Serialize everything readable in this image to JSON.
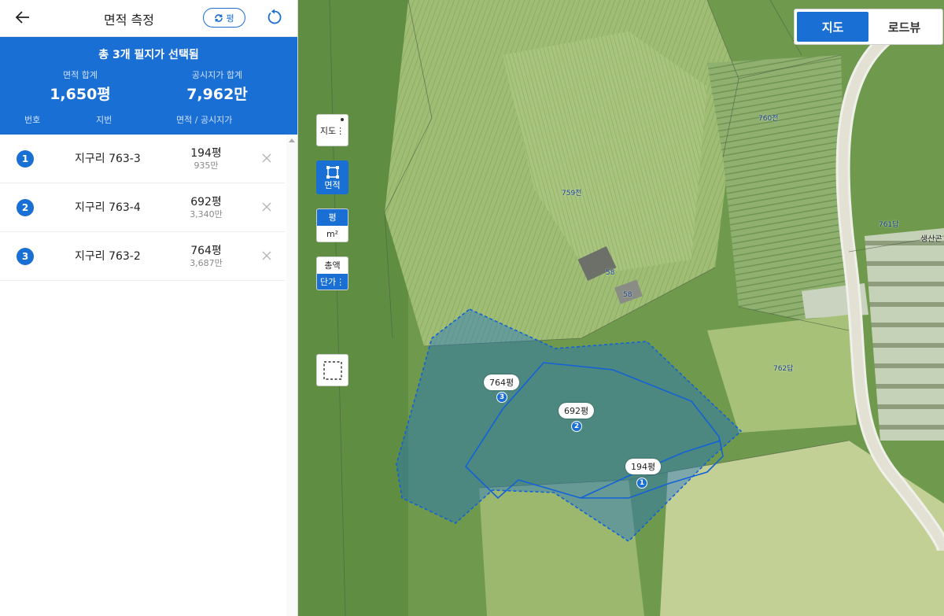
{
  "header": {
    "title": "면적 측정",
    "unit_toggle_label": "평"
  },
  "summary": {
    "title": "총 3개 필지가 선택됨",
    "area_label": "면적 합계",
    "area_value": "1,650평",
    "price_label": "공시지가 합계",
    "price_value": "7,962만"
  },
  "columns": {
    "num": "번호",
    "jibun": "지번",
    "area_price": "면적 / 공시지가"
  },
  "parcels": [
    {
      "num": "1",
      "jibun": "지구리 763-3",
      "area": "194평",
      "price": "935만"
    },
    {
      "num": "2",
      "jibun": "지구리 763-4",
      "area": "692평",
      "price": "3,340만"
    },
    {
      "num": "3",
      "jibun": "지구리 763-2",
      "area": "764평",
      "price": "3,687만"
    }
  ],
  "map_toggle": {
    "map": "지도",
    "roadview": "로드뷰"
  },
  "tools": {
    "map_layer": "지도",
    "area": "면적",
    "unit_pyeong": "평",
    "unit_sqm": "m²",
    "total_price": "총액",
    "unit_price": "단가"
  },
  "polygon_labels": [
    {
      "area": "764평",
      "num": "3"
    },
    {
      "area": "692평",
      "num": "2"
    },
    {
      "area": "194평",
      "num": "1"
    }
  ],
  "lot_labels": [
    "760전",
    "759전",
    "761답",
    "762답",
    "58",
    "58"
  ],
  "place_name": "생산곤",
  "colors": {
    "accent": "#1a6fd4"
  }
}
